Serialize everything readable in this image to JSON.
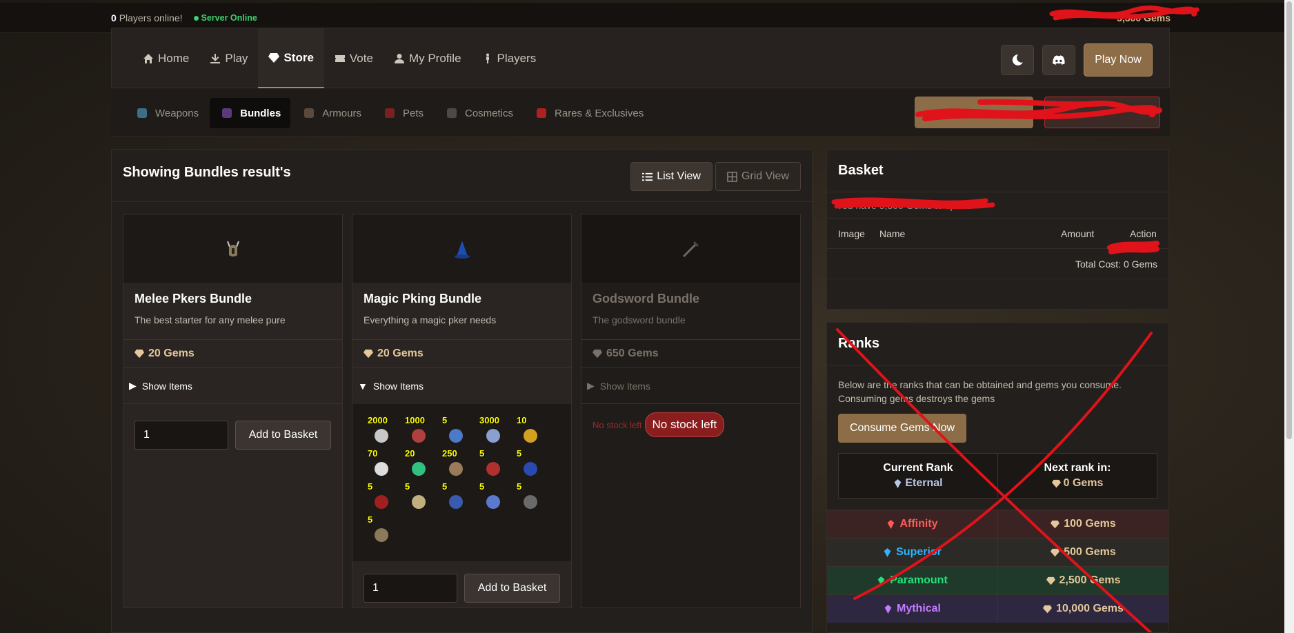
{
  "topbar": {
    "online_count": "0",
    "online_label": "Players online!",
    "server_status": "Server Online",
    "user_gems": "5,300 Gems"
  },
  "nav": {
    "items": [
      {
        "label": "Home",
        "icon": "home-icon"
      },
      {
        "label": "Play",
        "icon": "download-icon"
      },
      {
        "label": "Store",
        "icon": "diamond-icon",
        "active": true
      },
      {
        "label": "Vote",
        "icon": "ticket-icon"
      },
      {
        "label": "My Profile",
        "icon": "user-icon"
      },
      {
        "label": "Players",
        "icon": "person-icon"
      }
    ],
    "play_now": "Play Now"
  },
  "categories": [
    {
      "label": "Weapons"
    },
    {
      "label": "Bundles",
      "active": true
    },
    {
      "label": "Armours"
    },
    {
      "label": "Pets"
    },
    {
      "label": "Cosmetics"
    },
    {
      "label": "Rares & Exclusives"
    }
  ],
  "results": {
    "title": "Showing Bundles result's",
    "list_view": "List View",
    "grid_view": "Grid View"
  },
  "bundles": [
    {
      "title": "Melee Pkers Bundle",
      "desc": "The best starter for any melee pure",
      "price": "20 Gems",
      "show_items": "Show Items",
      "qty": "1",
      "add": "Add to Basket"
    },
    {
      "title": "Magic Pking Bundle",
      "desc": "Everything a magic pker needs",
      "price": "20 Gems",
      "show_items": "Show Items",
      "qty": "1",
      "add": "Add to Basket",
      "items": [
        "2000",
        "1000",
        "5",
        "3000",
        "10",
        "70",
        "20",
        "250",
        "5",
        "5",
        "5",
        "5",
        "5",
        "5",
        "5",
        "5"
      ]
    },
    {
      "title": "Godsword Bundle",
      "desc": "The godsword bundle",
      "price": "650 Gems",
      "show_items": "Show Items",
      "no_stock": "No stock left",
      "tooltip": "No stock left"
    }
  ],
  "basket": {
    "title": "Basket",
    "have": "You have 5,300 Gems to spend",
    "cols": [
      "Image",
      "Name",
      "Amount",
      "Action"
    ],
    "total_label": "Total Cost:",
    "total_value": "0 Gems"
  },
  "ranks": {
    "title": "Ranks",
    "desc": "Below are the ranks that can be obtained and gems you consume. Consuming gems destroys the gems",
    "consume": "Consume Gems Now",
    "current_label": "Current Rank",
    "current_value": "Eternal",
    "next_label": "Next rank in:",
    "next_value": "0 Gems",
    "rows": [
      {
        "name": "Affinity",
        "cost": "100 Gems",
        "color": "#ff5a5a",
        "bg": "#3a2322"
      },
      {
        "name": "Superior",
        "cost": "500 Gems",
        "color": "#2ab7ff",
        "bg": "#2c2a26"
      },
      {
        "name": "Paramount",
        "cost": "2,500 Gems",
        "color": "#22e07a",
        "bg": "#1f3a2a"
      },
      {
        "name": "Mythical",
        "cost": "10,000 Gems",
        "color": "#c27aff",
        "bg": "#2e2740"
      }
    ]
  }
}
